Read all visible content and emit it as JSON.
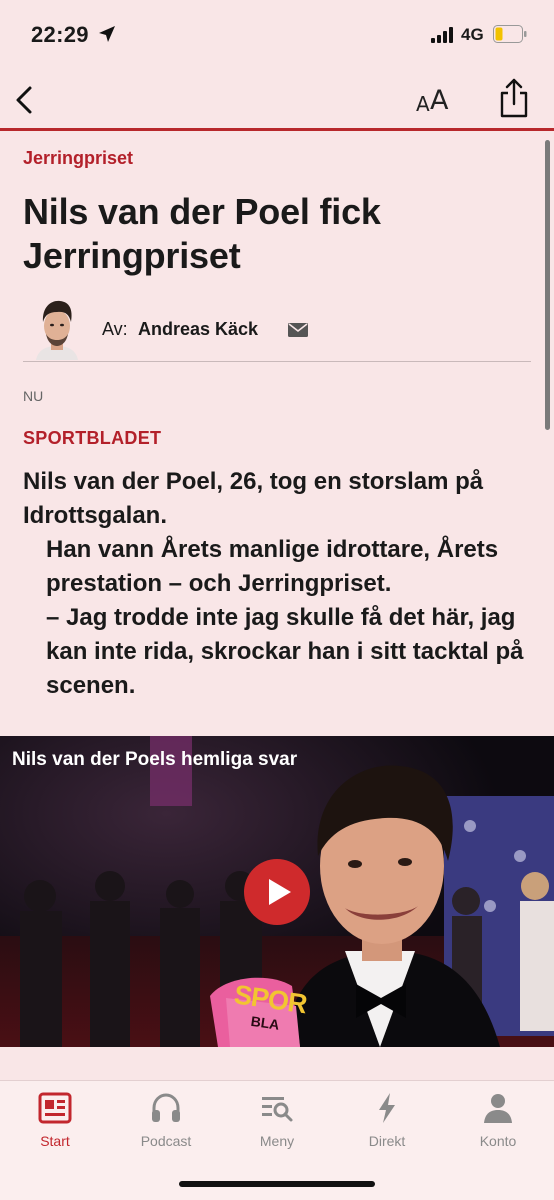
{
  "status_bar": {
    "time": "22:29",
    "network": "4G",
    "icons": [
      "location-arrow-icon",
      "signal-icon",
      "battery-icon"
    ]
  },
  "nav": {
    "text_size_small": "A",
    "text_size_big": "A",
    "icons": [
      "back-chevron-icon",
      "share-icon"
    ]
  },
  "article": {
    "kicker": "Jerringpriset",
    "headline": "Nils van der Poel fick Jerringpriset",
    "byline_prefix": "Av:",
    "author": "Andreas Käck",
    "timestamp": "NU",
    "section": "SPORTBLADET",
    "lead": [
      "Nils van der Poel, 26, tog en storslam på Idrottsgalan.",
      "Han vann Årets manlige idrottare, Årets prestation – och Jerringpriset.",
      "– Jag trodde inte jag skulle få det här, jag kan inte rida, skrockar han i sitt tacktal på scenen."
    ]
  },
  "video": {
    "title": "Nils van der Poels hemliga svar",
    "mic_flag_text": "SPOR",
    "mic_flag_subtext": "BLA"
  },
  "tabbar": {
    "tabs": [
      {
        "label": "Start",
        "icon": "newspaper-icon",
        "active": true
      },
      {
        "label": "Podcast",
        "icon": "headphones-icon",
        "active": false
      },
      {
        "label": "Meny",
        "icon": "menu-search-icon",
        "active": false
      },
      {
        "label": "Direkt",
        "icon": "lightning-icon",
        "active": false
      },
      {
        "label": "Konto",
        "icon": "person-icon",
        "active": false
      }
    ]
  },
  "colors": {
    "background": "#f9e6e7",
    "accent_red": "#b3202a",
    "tab_inactive": "#8a8a8a"
  }
}
